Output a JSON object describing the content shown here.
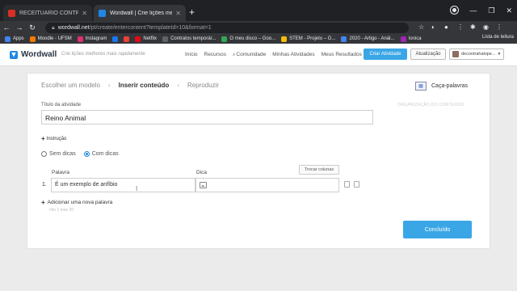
{
  "browser": {
    "tabs": [
      {
        "title": "RECEITUÁRIO CONTROLADO An",
        "active": false,
        "favicon_color": "#d93025"
      },
      {
        "title": "Wordwall | Crie lições melhores",
        "active": true,
        "favicon_color": "#1e88e5"
      }
    ],
    "new_tab": "+",
    "url_host": "wordwall.net",
    "url_path": "/pt/create/entercontent?templateId=10&format=1",
    "bookmarks": [
      {
        "label": "Apps",
        "color": "#4285f4"
      },
      {
        "label": "Moodle - UFSM",
        "color": "#f57c00"
      },
      {
        "label": "Instagram",
        "color": "#e1306c"
      },
      {
        "label": "",
        "color": "#1877f2"
      },
      {
        "label": "",
        "color": "#ea4335"
      },
      {
        "label": "Netflix",
        "color": "#e50914"
      },
      {
        "label": "Contratos temporár...",
        "color": "#5f6368"
      },
      {
        "label": "O meu disco – Goo...",
        "color": "#34a853"
      },
      {
        "label": "STEM - Projeto – G...",
        "color": "#fbbc04"
      },
      {
        "label": "2020 - Artigo - Anál...",
        "color": "#4285f4"
      },
      {
        "label": "Ionica",
        "color": "#9c27b0"
      }
    ],
    "reading_list": "Lista de leitura"
  },
  "wordwall": {
    "logo_text": "Wordwall",
    "tagline": "Crie lições melhores mais rapidamente",
    "nav": [
      "Início",
      "Recursos",
      "Comunidade",
      "Minhas Atividades",
      "Meus Resultados"
    ],
    "create_btn": "Criar Atividade",
    "update_btn": "Atualização",
    "user": "decontrahalope..."
  },
  "editor": {
    "steps": [
      "Escolher um modelo",
      "Inserir conteúdo",
      "Reproduzir"
    ],
    "activity_type": "Caça-palavras",
    "faded_right": "ORGANIZAÇÃO DO CONTEÚDO",
    "title_label": "Título da atividade",
    "title_value": "Reino Animal",
    "instruction": "Instrução",
    "radio_no_hints": "Sem dicas",
    "radio_with_hints": "Com dicas",
    "swap_columns": "Trocar colunas",
    "col_word": "Palavra",
    "col_hint": "Dica",
    "row_number": "1.",
    "row_word": "É um exemplo de anfíbio",
    "add_word": "Adicionar uma nova palavra",
    "min_max": "min 1  max 20",
    "done_btn": "Concluído"
  }
}
